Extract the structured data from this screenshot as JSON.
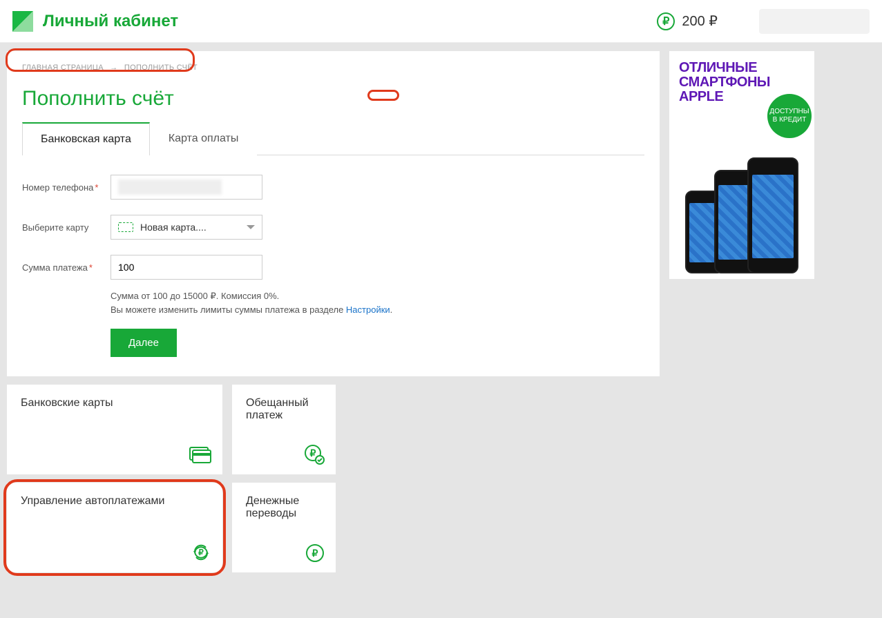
{
  "header": {
    "title": "Личный кабинет",
    "balance": "200 ₽"
  },
  "breadcrumb": {
    "home": "ГЛАВНАЯ СТРАНИЦА",
    "current": "ПОПОЛНИТЬ СЧЁТ"
  },
  "page_title": "Пополнить счёт",
  "tabs": {
    "bank_card": "Банковская карта",
    "pay_card": "Карта оплаты"
  },
  "form": {
    "phone_label": "Номер телефона",
    "card_label": "Выберите карту",
    "card_select_value": "Новая карта....",
    "amount_label": "Сумма платежа",
    "amount_value": "100",
    "hint_line1": "Сумма от 100 до 15000 ₽. Комиссия 0%.",
    "hint_line2": "Вы можете изменить лимиты суммы платежа в разделе ",
    "hint_link": "Настройки",
    "next": "Далее"
  },
  "tiles": {
    "bank_cards": "Банковские карты",
    "promised": "Обещанный платеж",
    "autopay": "Управление автоплатежами",
    "transfers": "Денежные переводы"
  },
  "ad": {
    "line1": "ОТЛИЧНЫЕ",
    "line2": "СМАРТФОНЫ",
    "line3": "APPLE",
    "badge": "ДОСТУПНЫ В КРЕДИТ"
  }
}
